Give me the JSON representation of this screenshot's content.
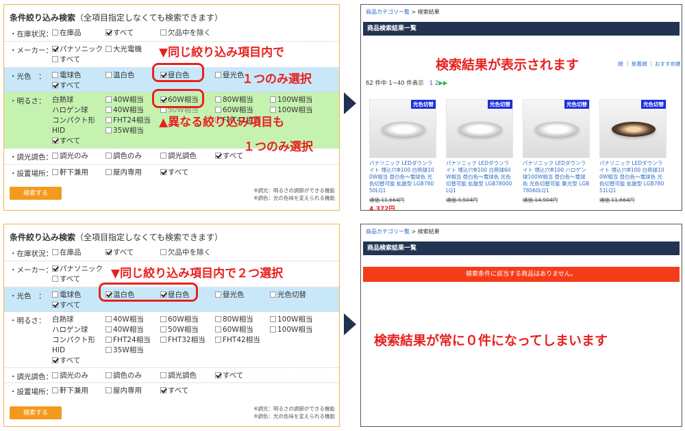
{
  "panel": {
    "title": "条件絞り込み検索",
    "title_note": "（全項目指定しなくても検索できます）",
    "search_button": "検索する",
    "footnote_1": "※調光：明るさの調節ができる機能",
    "footnote_2": "※調色：光の色味を変えられる機能"
  },
  "top_filter": {
    "stock": {
      "label": "・在庫状況：",
      "o1": "在庫品",
      "o2": "すべて",
      "o3": "欠品中を除く"
    },
    "maker": {
      "label": "・メーカー：",
      "o1": "パナソニック",
      "o2": "大光電機",
      "o3": "すべて"
    },
    "color": {
      "label": "・光色　：",
      "o1": "電球色",
      "o2": "温白色",
      "o3": "昼白色",
      "o4": "昼光色",
      "o5": "すべて"
    },
    "bright": {
      "label": "・明るさ：",
      "c1": [
        "白熱球",
        "ハロゲン球",
        "コンパクト形",
        "HID",
        "すべて"
      ],
      "c2": [
        "40W相当",
        "40W相当",
        "FHT24相当",
        "35W相当"
      ],
      "c3": [
        "60W相当",
        "50W相当"
      ],
      "c4": [
        "80W相当",
        "60W相当",
        "FHT42相当"
      ],
      "c5": [
        "100W相当",
        "100W相当"
      ]
    },
    "dim": {
      "label": "・調光調色：",
      "o1": "調光のみ",
      "o2": "調色のみ",
      "o3": "調光調色",
      "o4": "すべて"
    },
    "place": {
      "label": "・設置場所：",
      "o1": "軒下兼用",
      "o2": "屋内専用",
      "o3": "すべて"
    }
  },
  "bottom_filter": {
    "stock": {
      "label": "・在庫状況：",
      "o1": "在庫品",
      "o2": "すべて",
      "o3": "欠品中を除く"
    },
    "maker": {
      "label": "・メーカー：",
      "o1": "パナソニック",
      "o2": "すべて"
    },
    "color": {
      "label": "・光色　：",
      "o1": "電球色",
      "o2": "温白色",
      "o3": "昼白色",
      "o4": "昼光色",
      "o5": "光色切替",
      "o6": "すべて"
    },
    "bright": {
      "label": "・明るさ：",
      "c1": [
        "白熱球",
        "ハロゲン球",
        "コンパクト形",
        "HID",
        "すべて"
      ],
      "c2": [
        "40W相当",
        "40W相当",
        "FHT24相当",
        "35W相当"
      ],
      "c3": [
        "60W相当",
        "50W相当",
        "FHT32相当"
      ],
      "c4": [
        "80W相当",
        "60W相当",
        "FHT42相当"
      ],
      "c5": [
        "100W相当",
        "100W相当"
      ]
    },
    "dim": {
      "label": "・調光調色：",
      "o1": "調光のみ",
      "o2": "調色のみ",
      "o3": "調光調色",
      "o4": "すべて"
    },
    "place": {
      "label": "・設置場所：",
      "o1": "軒下兼用",
      "o2": "屋内専用",
      "o3": "すべて"
    }
  },
  "annotations": {
    "same_item": "▼同じ絞り込み項目内で",
    "only_one": "１つのみ選択",
    "different_item": "▲異なる絞り込み項目も",
    "only_one_2": "１つのみ選択",
    "same_item_two": "▼同じ絞り込み項目内で２つ選択",
    "results_shown": "検索結果が表示されます",
    "zero_results": "検索結果が常に０件になってしまいます"
  },
  "results": {
    "crumb_link": "商品カテゴリー覧",
    "crumb_sep": ">",
    "crumb_current": "検索結果",
    "header": "商品検索結果一覧",
    "sort_1": "順",
    "sort_2": "新着順",
    "sort_3": "おすすめ順",
    "count_text": "62 件中 1~40 件表示",
    "pages": "1 2",
    "next": "▶▶",
    "no_results": "検索条件に該当する商品はありません。",
    "products": [
      {
        "badge": "光色切替",
        "name": "パナソニック LEDダウンライト 埋込穴Φ100 白熱球100W相当 昼白色～電球色 光色切替可能 拡散型 LGB78050LQ1",
        "price": "通価 11,664円",
        "sale": "4,372円"
      },
      {
        "badge": "光色切替",
        "name": "パナソニック LEDダウンライト 埋込穴Φ100 白熱球60W相当 昼白色～電球色 光色切替可能 拡散型 LGB78000LQ1",
        "price": "通価 9,504円",
        "sale": ""
      },
      {
        "badge": "光色切替",
        "name": "パナソニック LEDダウンライト 埋込穴Φ100 ハロゲン球100W相当 昼白色～電球色 光色切替可能 集光型 LGB78060LQ1",
        "price": "通価 14,904円",
        "sale": ""
      },
      {
        "badge": "光色切替",
        "name": "パナソニック LEDダウンライト 埋込穴Φ100 白熱球100W相当 昼白色～電球色 光色切替可能 拡散型 LGB78051LQ1",
        "price": "通価 11,664円",
        "sale": ""
      }
    ]
  }
}
